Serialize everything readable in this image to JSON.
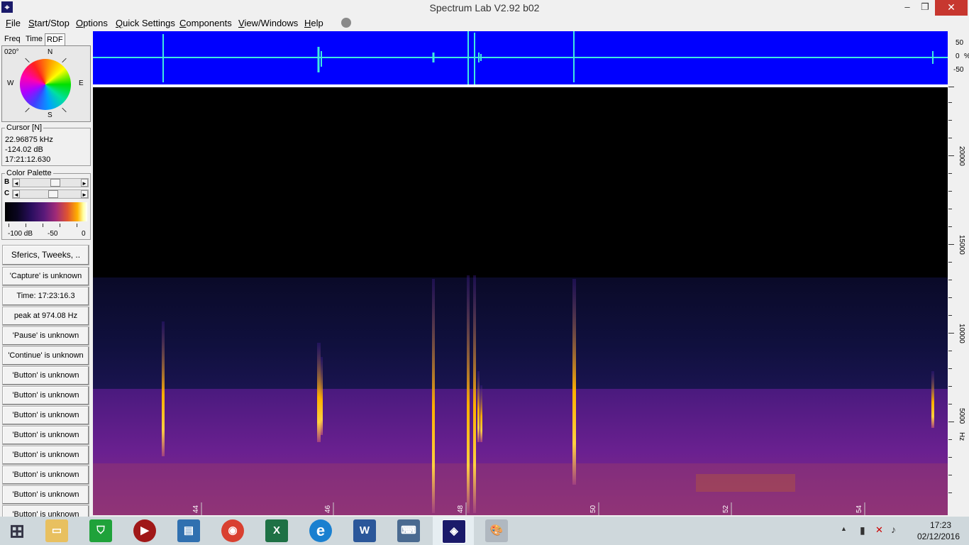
{
  "window": {
    "title": "Spectrum Lab V2.92 b02",
    "minimize_glyph": "–",
    "maximize_glyph": "❐",
    "close_glyph": "✕",
    "app_icon": "spectrum-lab-icon"
  },
  "menu": [
    {
      "label": "File",
      "ul": "F",
      "rest": "ile"
    },
    {
      "label": "Start/Stop",
      "ul": "S",
      "rest": "tart/Stop"
    },
    {
      "label": "Options",
      "ul": "O",
      "rest": "ptions"
    },
    {
      "label": "Quick Settings",
      "ul": "Q",
      "rest": "uick Settings"
    },
    {
      "label": "Components",
      "ul": "C",
      "rest": "omponents"
    },
    {
      "label": "View/Windows",
      "ul": "V",
      "rest": "iew/Windows"
    },
    {
      "label": "Help",
      "ul": "H",
      "rest": "elp"
    }
  ],
  "tabs": {
    "freq": "Freq",
    "time": "Time",
    "rdf": "RDF"
  },
  "rdf": {
    "bearing": "020°",
    "n": "N",
    "e": "E",
    "s": "S",
    "w": "W"
  },
  "cursor": {
    "title": "Cursor [N]",
    "freq": "22.96875 kHz",
    "level": "-124.02 dB",
    "time": "17:21:12.630"
  },
  "palette": {
    "title": "Color Palette",
    "b_label": "B",
    "c_label": "C",
    "b_value": 0.6,
    "c_value": 0.55,
    "lbl_min": "-100 dB",
    "lbl_mid": "-50",
    "lbl_max": "0"
  },
  "buttons": [
    "Sferics, Tweeks, ..",
    "'Capture' is unknown",
    "Time:  17:23:16.3",
    "peak at 974.08 Hz",
    "'Pause' is unknown",
    "'Continue' is unknown",
    "'Button' is unknown",
    "'Button' is unknown",
    "'Button' is unknown",
    "'Button' is unknown",
    "'Button' is unknown",
    "'Button' is unknown",
    "'Button' is unknown",
    "'Button' is unknown"
  ],
  "waveform": {
    "labels": [
      "50",
      "0",
      "-50"
    ],
    "unit": "%"
  },
  "spectrogram": {
    "time_labels": [
      "44",
      "46",
      "48",
      "50",
      "52",
      "54"
    ],
    "freq_labels": [
      "20000",
      "15000",
      "10000",
      "5000"
    ],
    "freq_unit": "Hz",
    "colors": {
      "bg": "#000000",
      "noise": "#3a1a7a",
      "hot": "#ff8c00",
      "bright": "#ffd000"
    }
  },
  "taskbar": {
    "apps": [
      {
        "name": "start",
        "glyph": "⊞",
        "color": "#e8eef2"
      },
      {
        "name": "file-explorer",
        "glyph": "▭",
        "color": "#e8c060"
      },
      {
        "name": "store",
        "glyph": "⛉",
        "color": "#1fa23a"
      },
      {
        "name": "media",
        "glyph": "▶",
        "color": "#a01818"
      },
      {
        "name": "remote",
        "glyph": "▤",
        "color": "#3070b0"
      },
      {
        "name": "chrome",
        "glyph": "◉",
        "color": "#d94030"
      },
      {
        "name": "excel",
        "glyph": "X",
        "color": "#1e7145"
      },
      {
        "name": "internet-explorer",
        "glyph": "e",
        "color": "#1a80d0"
      },
      {
        "name": "word",
        "glyph": "W",
        "color": "#2b579a"
      },
      {
        "name": "network",
        "glyph": "⌨",
        "color": "#4a6a90"
      },
      {
        "name": "spectrum-lab",
        "glyph": "◈",
        "color": "#1a1a6a"
      },
      {
        "name": "paint",
        "glyph": "🎨",
        "color": "#b0b8c0"
      }
    ],
    "tray": {
      "up": "▲",
      "battery": "▮",
      "network": "✕",
      "volume": "♪"
    },
    "clock_time": "17:23",
    "clock_date": "02/12/2016"
  }
}
